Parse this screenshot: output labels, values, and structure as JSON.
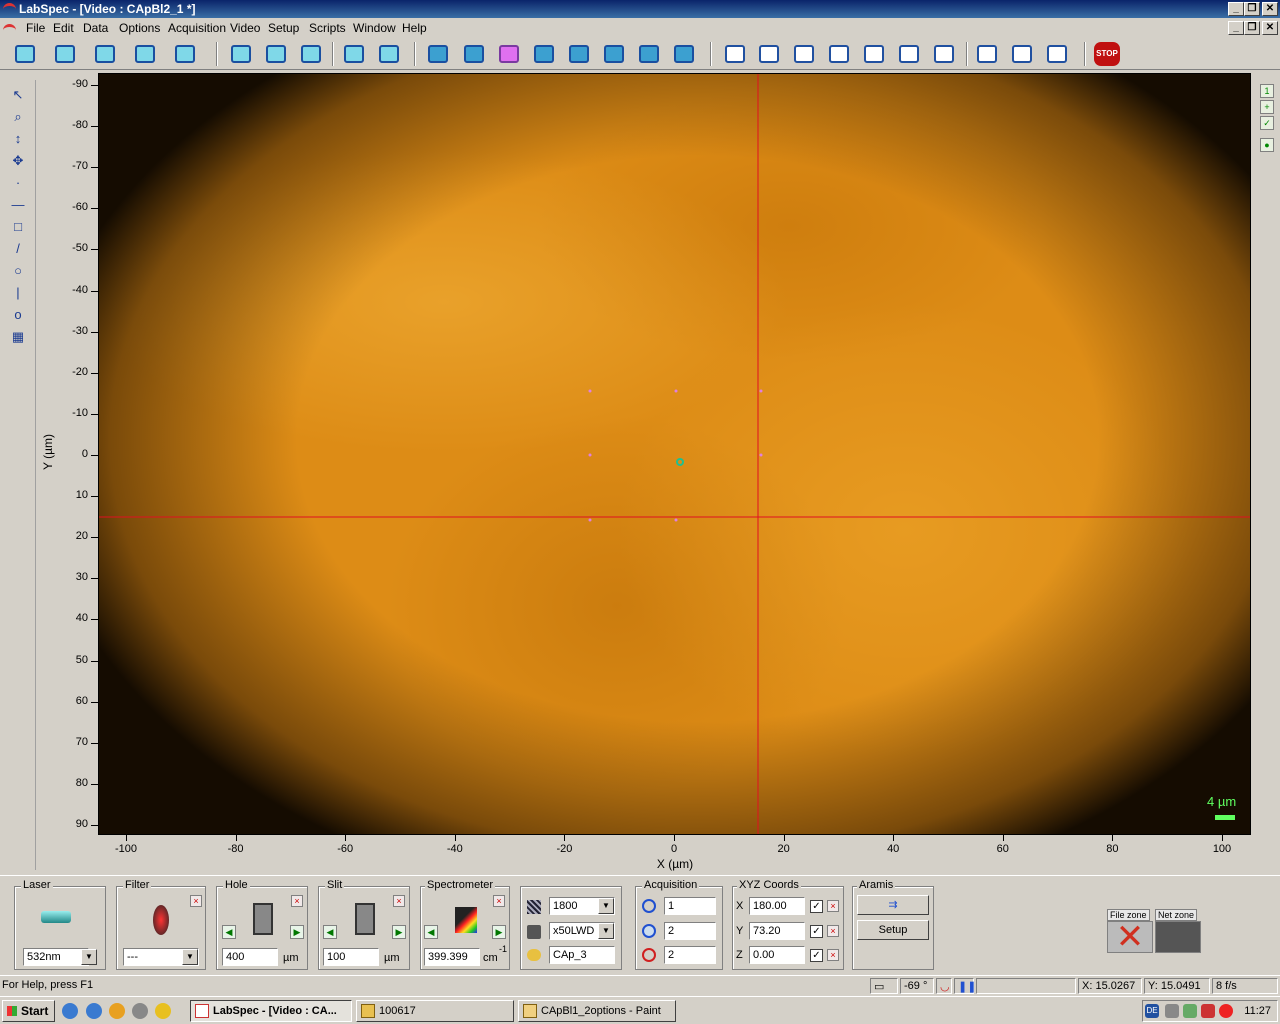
{
  "window": {
    "title": "LabSpec - [Video : CApBl2_1 *]"
  },
  "menu": [
    "File",
    "Edit",
    "Data",
    "Options",
    "Acquisition",
    "Video",
    "Setup",
    "Scripts",
    "Window",
    "Help"
  ],
  "plot": {
    "xlabel": "X (µm)",
    "ylabel": "Y (µm)",
    "xticks": [
      "-100",
      "-80",
      "-60",
      "-40",
      "-20",
      "0",
      "20",
      "40",
      "60",
      "80",
      "100"
    ],
    "yticks": [
      "-90",
      "-80",
      "-70",
      "-60",
      "-50",
      "-40",
      "-30",
      "-20",
      "-10",
      "0",
      "10",
      "20",
      "30",
      "40",
      "50",
      "60",
      "70",
      "80",
      "90"
    ],
    "scalebar": "4 µm",
    "image_color": "#dd8c16",
    "crosshair_color": "#e01020"
  },
  "panel": {
    "laser": {
      "label": "Laser",
      "value": "532nm"
    },
    "filter": {
      "label": "Filter",
      "value": "---"
    },
    "hole": {
      "label": "Hole",
      "value": "400",
      "unit": "µm"
    },
    "slit": {
      "label": "Slit",
      "value": "100",
      "unit": "µm"
    },
    "spectrometer": {
      "label": "Spectrometer",
      "value": "399.399",
      "unit": "cm",
      "unit_exp": "-1"
    },
    "grating": "1800",
    "objective": "x50LWD",
    "sample": "CAp_3",
    "acquisition": {
      "label": "Acquisition",
      "v1": "1",
      "v2": "2",
      "v3": "2"
    },
    "xyz": {
      "label": "XYZ Coords",
      "x_label": "X",
      "y_label": "Y",
      "z_label": "Z",
      "x": "180.00",
      "y": "73.20",
      "z": "0.00",
      "x_check": "✓",
      "y_check": "✓",
      "z_check": "✓"
    },
    "aramis": {
      "label": "Aramis",
      "setup": "Setup"
    },
    "zones": {
      "file": "File zone",
      "net": "Net zone"
    }
  },
  "status": {
    "help": "For Help, press F1",
    "angle": "-69 °",
    "x": "X: 15.0267",
    "y": "Y: 15.0491",
    "fps": "8 f/s"
  },
  "taskbar": {
    "start": "Start",
    "tasks": [
      "LabSpec - [Video : CA...",
      "100617",
      "CApBl1_2options - Paint"
    ],
    "tray_lang": "DE",
    "clock": "11:27"
  }
}
